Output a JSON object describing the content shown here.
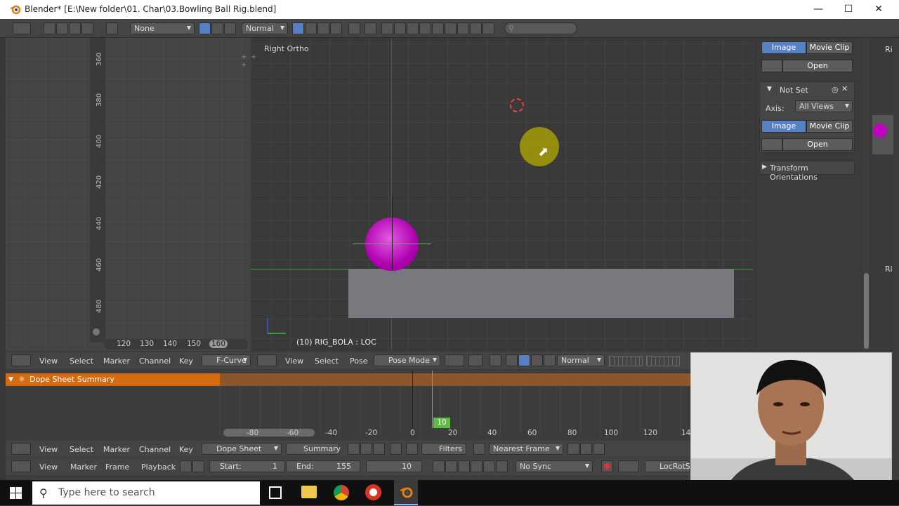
{
  "window": {
    "title": "Blender* [E:\\New folder\\01. Char\\03.Bowling Ball Rig.blend]"
  },
  "topbar": {
    "keying_set": "None",
    "blend_mode": "Normal"
  },
  "graph_editor": {
    "v_ticks": [
      "360",
      "380",
      "400",
      "420",
      "440",
      "460",
      "480"
    ],
    "h_ticks": [
      "120",
      "130",
      "140",
      "150",
      "160"
    ]
  },
  "viewport": {
    "view_label": "Right Ortho",
    "object_label": "(10) RIG_BOLA : LOC"
  },
  "properties_panel": {
    "image_tab": "Image",
    "movie_clip_tab": "Movie Clip",
    "open_button": "Open",
    "not_set_label": "Not Set",
    "axis_label": "Axis:",
    "axis_value": "All Views",
    "transform_orientations": "Transform Orientations"
  },
  "right_strip": {
    "label": "Ri"
  },
  "graph_header": {
    "view": "View",
    "select": "Select",
    "marker": "Marker",
    "channel": "Channel",
    "key": "Key",
    "mode": "F-Curve"
  },
  "viewport_header": {
    "view": "View",
    "select": "Select",
    "pose": "Pose",
    "mode": "Pose Mode",
    "pivot": "Normal"
  },
  "dope_sheet": {
    "summary": "Dope Sheet Summary",
    "current_frame": "10",
    "ruler": [
      "-80",
      "-60",
      "-40",
      "-20",
      "0",
      "20",
      "40",
      "60",
      "80",
      "100",
      "120",
      "14"
    ]
  },
  "dope_header": {
    "view": "View",
    "select": "Select",
    "marker": "Marker",
    "channel": "Channel",
    "key": "Key",
    "mode": "Dope Sheet",
    "summary": "Summary",
    "filters": "Filters",
    "snap": "Nearest Frame"
  },
  "timeline": {
    "view": "View",
    "marker": "Marker",
    "frame": "Frame",
    "playback": "Playback",
    "start_label": "Start:",
    "start_value": "1",
    "end_label": "End:",
    "end_value": "155",
    "current": "10",
    "sync": "No Sync",
    "keying": "LocRotSc"
  },
  "taskbar": {
    "search_placeholder": "Type here to search"
  },
  "colors": {
    "accent": "#5680c2",
    "dope_summary": "#d56b11",
    "ball": "#c000c0",
    "frame_marker": "#5fba46"
  }
}
